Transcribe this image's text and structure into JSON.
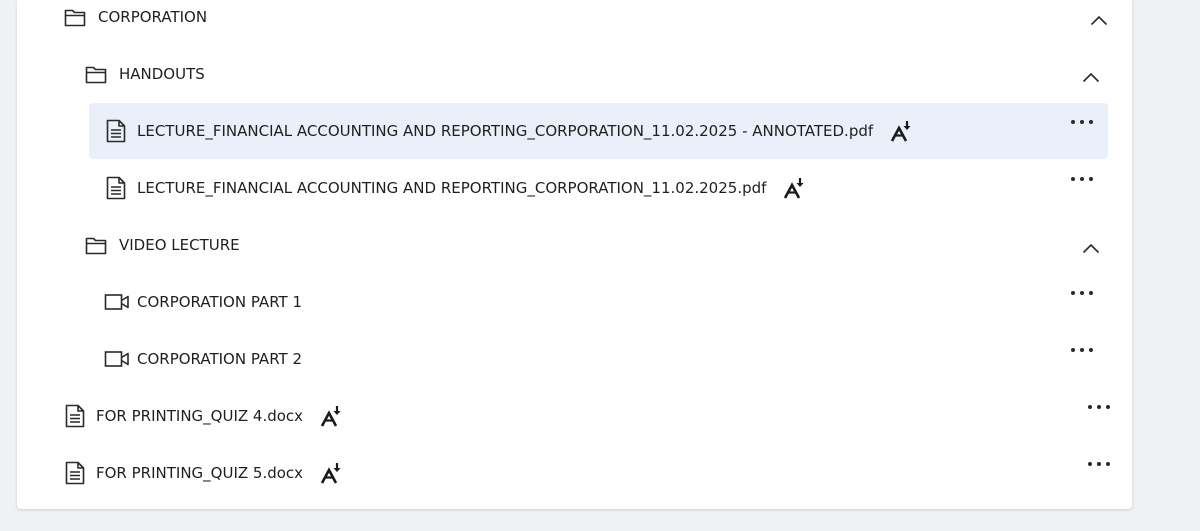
{
  "tree": {
    "corporation": {
      "label": "CORPORATION",
      "icon": "folder-open-icon"
    },
    "handouts": {
      "label": "HANDOUTS",
      "icon": "folder-open-icon"
    },
    "handout_files": [
      {
        "label": "LECTURE_FINANCIAL ACCOUNTING AND REPORTING_CORPORATION_11.02.2025 - ANNOTATED.pdf",
        "icon": "document-icon",
        "selected": true
      },
      {
        "label": "LECTURE_FINANCIAL ACCOUNTING AND REPORTING_CORPORATION_11.02.2025.pdf",
        "icon": "document-icon",
        "selected": false
      }
    ],
    "video_lecture": {
      "label": "VIDEO LECTURE",
      "icon": "folder-open-icon"
    },
    "videos": [
      {
        "label": "CORPORATION PART 1",
        "icon": "video-camera-icon"
      },
      {
        "label": "CORPORATION PART 2",
        "icon": "video-camera-icon"
      }
    ],
    "files": [
      {
        "label": "FOR PRINTING_QUIZ 4.docx",
        "icon": "document-icon"
      },
      {
        "label": "FOR PRINTING_QUIZ 5.docx",
        "icon": "document-icon"
      }
    ]
  },
  "colors": {
    "highlight": "#e9f0fa",
    "text": "#1f1f1f"
  }
}
